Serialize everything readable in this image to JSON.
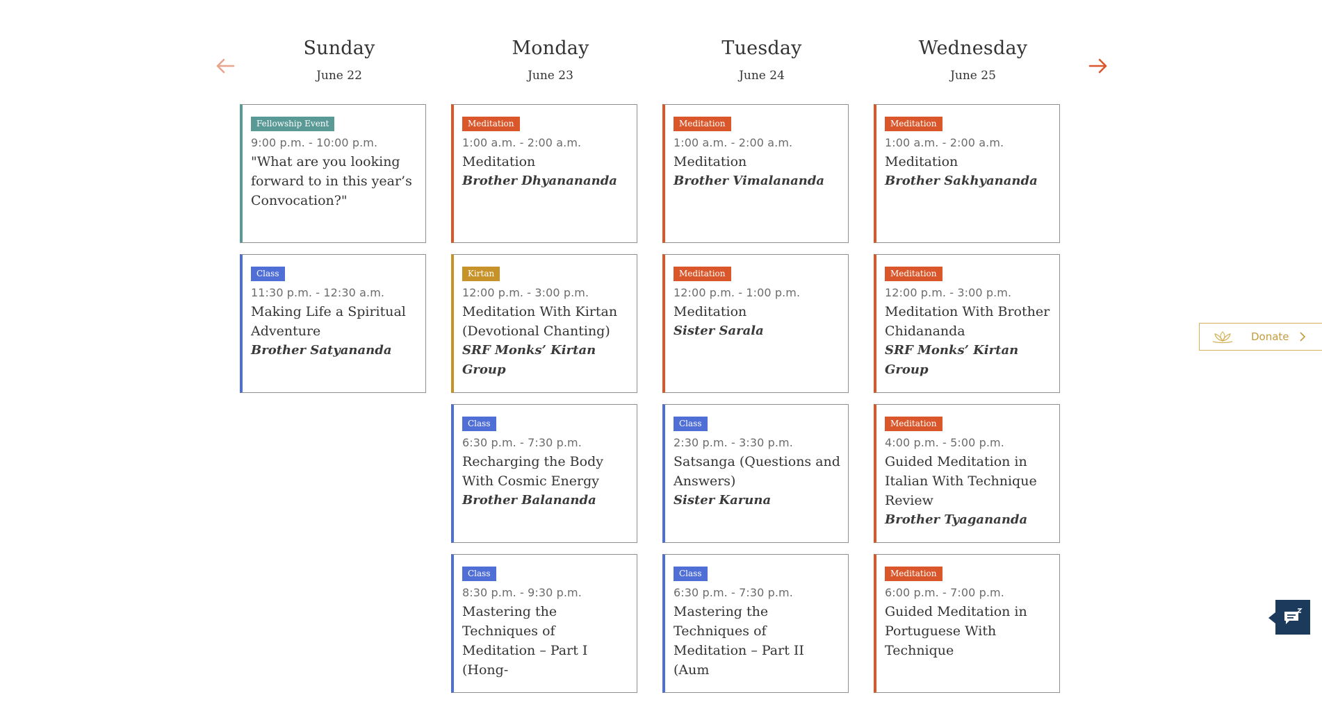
{
  "navigation": {
    "prev_icon": "arrow-left-icon",
    "next_icon": "arrow-right-icon",
    "accent_color": "#d9572b"
  },
  "categories": {
    "fellowship": {
      "label": "Fellowship Event",
      "color": "#5a9a96"
    },
    "meditation": {
      "label": "Meditation",
      "color": "#d9572b"
    },
    "class": {
      "label": "Class",
      "color": "#4f6fd6"
    },
    "kirtan": {
      "label": "Kirtan",
      "color": "#c8922a"
    }
  },
  "days": [
    {
      "name": "Sunday",
      "date": "June 22",
      "events": [
        {
          "badge": "Fellowship Event",
          "time": "9:00 p.m. - 10:00 p.m.",
          "title": "\"What are you looking forward to in this year’s Convocation?\"",
          "speaker": ""
        },
        {
          "badge": "Class",
          "time": "11:30 p.m. - 12:30 a.m.",
          "title": "Making Life a Spiritual Adventure",
          "speaker": "Brother Satyananda"
        }
      ]
    },
    {
      "name": "Monday",
      "date": "June 23",
      "events": [
        {
          "badge": "Meditation",
          "time": "1:00 a.m. - 2:00 a.m.",
          "title": "Meditation",
          "speaker": "Brother Dhyanananda"
        },
        {
          "badge": "Kirtan",
          "time": "12:00 p.m. - 3:00 p.m.",
          "title": "Meditation With Kirtan (Devotional Chanting)",
          "speaker": "SRF Monks’ Kirtan Group"
        },
        {
          "badge": "Class",
          "time": "6:30 p.m. - 7:30 p.m.",
          "title": "Recharging the Body With Cosmic Energy",
          "speaker": "Brother Balananda"
        },
        {
          "badge": "Class",
          "time": "8:30 p.m. - 9:30 p.m.",
          "title": "Mastering the Techniques of Meditation – Part I (Hong-",
          "speaker": ""
        }
      ]
    },
    {
      "name": "Tuesday",
      "date": "June 24",
      "events": [
        {
          "badge": "Meditation",
          "time": "1:00 a.m. - 2:00 a.m.",
          "title": "Meditation",
          "speaker": "Brother Vimalananda"
        },
        {
          "badge": "Meditation",
          "time": "12:00 p.m. - 1:00 p.m.",
          "title": "Meditation",
          "speaker": "Sister Sarala"
        },
        {
          "badge": "Class",
          "time": "2:30 p.m. - 3:30 p.m.",
          "title": "Satsanga (Questions and Answers)",
          "speaker": "Sister Karuna"
        },
        {
          "badge": "Class",
          "time": "6:30 p.m. - 7:30 p.m.",
          "title": "Mastering the Techniques of Meditation – Part II (Aum",
          "speaker": ""
        }
      ]
    },
    {
      "name": "Wednesday",
      "date": "June 25",
      "events": [
        {
          "badge": "Meditation",
          "time": "1:00 a.m. - 2:00 a.m.",
          "title": "Meditation",
          "speaker": "Brother Sakhyananda"
        },
        {
          "badge": "Meditation",
          "time": "12:00 p.m. - 3:00 p.m.",
          "title": "Meditation With Brother Chidananda",
          "speaker": "SRF Monks’ Kirtan Group"
        },
        {
          "badge": "Meditation",
          "time": "4:00 p.m. - 5:00 p.m.",
          "title": "Guided Meditation in Italian With Technique Review",
          "speaker": "Brother Tyagananda"
        },
        {
          "badge": "Meditation",
          "time": "6:00 p.m. - 7:00 p.m.",
          "title": "Guided Meditation in Portuguese With Technique",
          "speaker": ""
        }
      ]
    }
  ],
  "donate": {
    "label": "Donate",
    "icon": "lotus-icon",
    "color": "#c59a3a"
  },
  "chat": {
    "icon": "chat-icon",
    "color": "#1b3a5c"
  }
}
